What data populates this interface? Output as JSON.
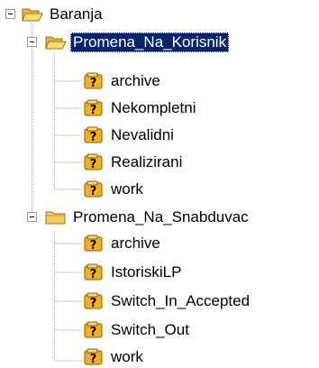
{
  "colors": {
    "selection_background": "#0a246a",
    "selection_text": "#ffffff",
    "connector": "#a0a0a0",
    "folder": "#f3cd62",
    "unknown_icon": "#e8a000"
  },
  "tree": {
    "root": {
      "label": "Baranja",
      "icon": "open-folder-icon",
      "expanded": true
    },
    "groups": [
      {
        "label": "Promena_Na_Korisnik",
        "icon": "open-folder-icon",
        "expanded": true,
        "selected": true,
        "children": [
          {
            "label": "archive",
            "icon": "unknown-item-icon"
          },
          {
            "label": "Nekompletni",
            "icon": "unknown-item-icon"
          },
          {
            "label": "Nevalidni",
            "icon": "unknown-item-icon"
          },
          {
            "label": "Realizirani",
            "icon": "unknown-item-icon"
          },
          {
            "label": "work",
            "icon": "unknown-item-icon"
          }
        ]
      },
      {
        "label": "Promena_Na_Snabduvac",
        "icon": "closed-folder-icon",
        "expanded": true,
        "selected": false,
        "children": [
          {
            "label": "archive",
            "icon": "unknown-item-icon"
          },
          {
            "label": "IstoriskiLP",
            "icon": "unknown-item-icon"
          },
          {
            "label": "Switch_In_Accepted",
            "icon": "unknown-item-icon"
          },
          {
            "label": "Switch_Out",
            "icon": "unknown-item-icon"
          },
          {
            "label": "work",
            "icon": "unknown-item-icon"
          }
        ]
      }
    ]
  }
}
